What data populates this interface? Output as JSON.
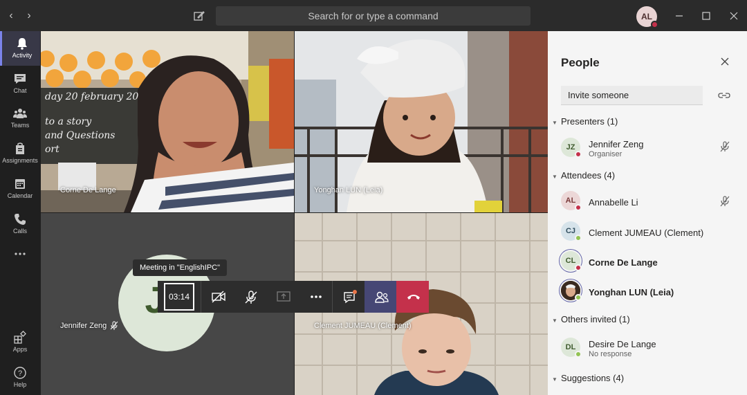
{
  "app": {
    "search_placeholder": "Search for or type a command",
    "user_initials": "AL"
  },
  "rail": {
    "items": [
      {
        "label": "Activity"
      },
      {
        "label": "Chat"
      },
      {
        "label": "Teams"
      },
      {
        "label": "Assignments"
      },
      {
        "label": "Calendar"
      },
      {
        "label": "Calls"
      },
      {
        "label": "..."
      },
      {
        "label": "Apps"
      },
      {
        "label": "Help"
      }
    ]
  },
  "meeting": {
    "tiles": [
      {
        "name": "Corne De Lange"
      },
      {
        "name": "Yonghan LUN (Leia)"
      },
      {
        "name": "Jennifer Zeng",
        "initials": "JZ"
      },
      {
        "name": "Clement JUMEAU (Clement)"
      }
    ],
    "tooltip": "Meeting in \"EnglishIPC\"",
    "timer": "03:14",
    "chalkboard_text": [
      "day 20 february 20",
      "to a story",
      "and Questions",
      "ort"
    ]
  },
  "panel": {
    "title": "People",
    "invite_placeholder": "Invite someone",
    "sections": {
      "presenters": "Presenters (1)",
      "attendees": "Attendees (4)",
      "others": "Others invited (1)",
      "suggestions": "Suggestions (4)"
    },
    "people": [
      {
        "initials": "JZ",
        "name": "Jennifer Zeng",
        "sub": "Organiser"
      },
      {
        "initials": "AL",
        "name": "Annabelle Li"
      },
      {
        "initials": "CJ",
        "name": "Clement JUMEAU (Clement)"
      },
      {
        "initials": "CL",
        "name": "Corne De Lange"
      },
      {
        "initials": "",
        "name": "Yonghan LUN (Leia)"
      },
      {
        "initials": "DL",
        "name": "Desire De Lange",
        "sub": "No response"
      }
    ]
  },
  "colors": {
    "accent": "#6264a7",
    "hangup": "#c4314b",
    "busy": "#c4314b",
    "available": "#92c353"
  }
}
